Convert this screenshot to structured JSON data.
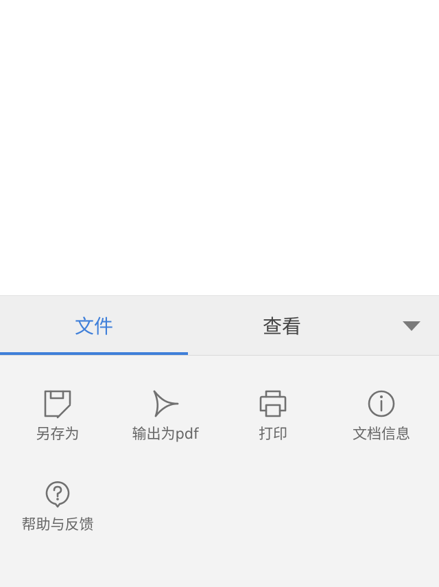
{
  "tabs": [
    {
      "label": "文件"
    },
    {
      "label": "查看"
    }
  ],
  "colors": {
    "accent": "#3f7fd9",
    "icon": "#707070",
    "label": "#666666",
    "panel_bg": "#f3f3f3"
  },
  "tools": [
    {
      "label": "另存为",
      "icon": "save-as-icon"
    },
    {
      "label": "输出为pdf",
      "icon": "export-pdf-icon"
    },
    {
      "label": "打印",
      "icon": "printer-icon"
    },
    {
      "label": "文档信息",
      "icon": "info-icon"
    },
    {
      "label": "帮助与反馈",
      "icon": "help-feedback-icon"
    }
  ],
  "dropdown_icon": "triangle-down-icon"
}
